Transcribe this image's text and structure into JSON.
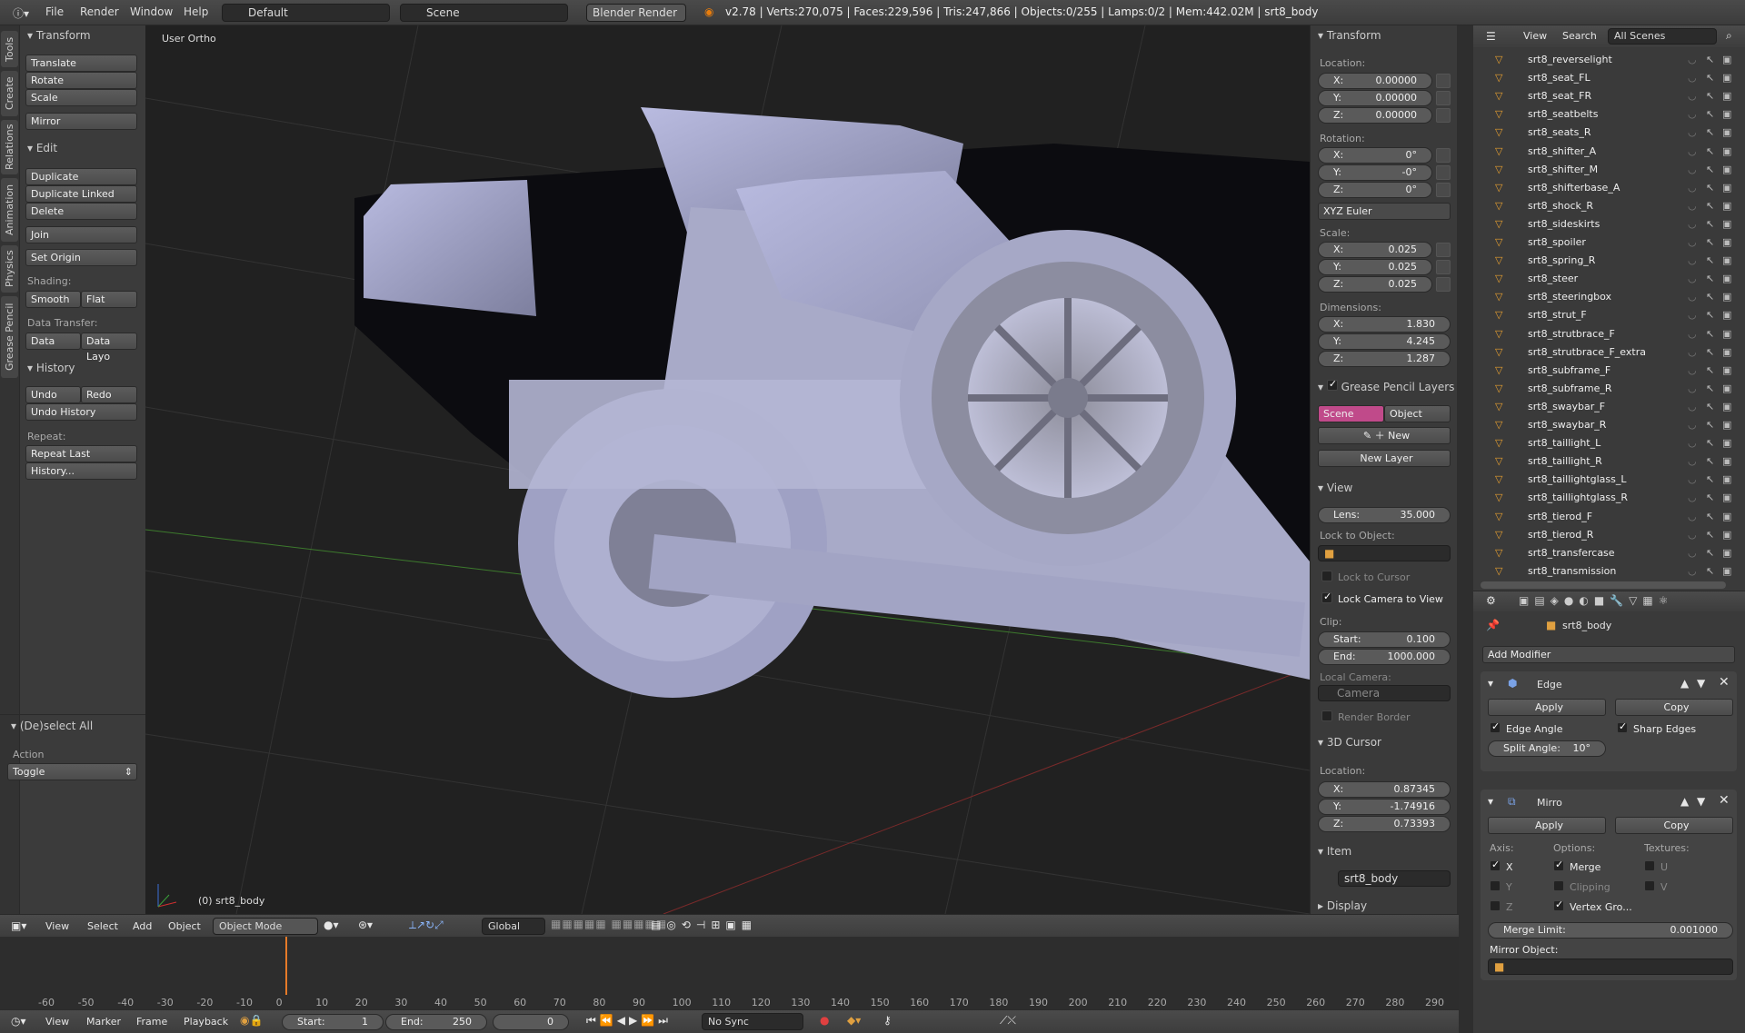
{
  "topbar": {
    "menus": [
      "File",
      "Render",
      "Window",
      "Help"
    ],
    "layout": "Default",
    "scene": "Scene",
    "engine": "Blender Render",
    "stats": "v2.78 | Verts:270,075 | Faces:229,596 | Tris:247,866 | Objects:0/255 | Lamps:0/2 | Mem:442.02M | srt8_body"
  },
  "vtabs": [
    "Tools",
    "Create",
    "Relations",
    "Animation",
    "Physics",
    "Grease Pencil"
  ],
  "tool": {
    "transform": "Transform",
    "translate": "Translate",
    "rotate": "Rotate",
    "scale": "Scale",
    "mirror": "Mirror",
    "edit": "Edit",
    "duplicate": "Duplicate",
    "duplicate_linked": "Duplicate Linked",
    "delete": "Delete",
    "join": "Join",
    "set_origin": "Set Origin",
    "shading": "Shading:",
    "smooth": "Smooth",
    "flat": "Flat",
    "data_transfer": "Data Transfer:",
    "data": "Data",
    "data_layo": "Data Layo",
    "history": "History",
    "undo": "Undo",
    "redo": "Redo",
    "undo_history": "Undo History",
    "repeat": "Repeat:",
    "repeat_last": "Repeat Last",
    "history_dots": "History...",
    "deselect": "(De)select All",
    "action": "Action",
    "toggle": "Toggle"
  },
  "viewport": {
    "label": "User Ortho",
    "object": "(0) srt8_body"
  },
  "props": {
    "transform": "Transform",
    "location": "Location:",
    "loc": [
      "0.00000",
      "0.00000",
      "0.00000"
    ],
    "rotation": "Rotation:",
    "rot": [
      "0°",
      "-0°",
      "0°"
    ],
    "euler": "XYZ Euler",
    "scale": "Scale:",
    "scl": [
      "0.025",
      "0.025",
      "0.025"
    ],
    "dimensions": "Dimensions:",
    "dim": [
      "1.830",
      "4.245",
      "1.287"
    ],
    "axes": [
      "X:",
      "Y:",
      "Z:"
    ],
    "grease": "Grease Pencil Layers",
    "scene_tab": "Scene",
    "object_tab": "Object",
    "new": "New",
    "new_layer": "New Layer",
    "view": "View",
    "lens_l": "Lens:",
    "lens": "35.000",
    "lock_obj": "Lock to Object:",
    "lock_cursor": "Lock to Cursor",
    "lock_cam": "Lock Camera to View",
    "clip": "Clip:",
    "start_l": "Start:",
    "start": "0.100",
    "end_l": "End:",
    "end": "1000.000",
    "local_cam": "Local Camera:",
    "camera": "Camera",
    "render_border": "Render Border",
    "cursor3d": "3D Cursor",
    "cloc": [
      "0.87345",
      "-1.74916",
      "0.73393"
    ],
    "item": "Item",
    "item_name": "srt8_body",
    "display": "Display"
  },
  "outliner": {
    "view": "View",
    "search": "Search",
    "scenes": "All Scenes",
    "items": [
      "srt8_reverselight",
      "srt8_seat_FL",
      "srt8_seat_FR",
      "srt8_seatbelts",
      "srt8_seats_R",
      "srt8_shifter_A",
      "srt8_shifter_M",
      "srt8_shifterbase_A",
      "srt8_shock_R",
      "srt8_sideskirts",
      "srt8_spoiler",
      "srt8_spring_R",
      "srt8_steer",
      "srt8_steeringbox",
      "srt8_strut_F",
      "srt8_strutbrace_F",
      "srt8_strutbrace_F_extra",
      "srt8_subframe_F",
      "srt8_subframe_R",
      "srt8_swaybar_F",
      "srt8_swaybar_R",
      "srt8_taillight_L",
      "srt8_taillight_R",
      "srt8_taillightglass_L",
      "srt8_taillightglass_R",
      "srt8_tierod_F",
      "srt8_tierod_R",
      "srt8_transfercase",
      "srt8_transmission"
    ]
  },
  "modifiers": {
    "object": "srt8_body",
    "add": "Add Modifier",
    "edge": "Edge",
    "apply": "Apply",
    "copy": "Copy",
    "edge_angle": "Edge Angle",
    "sharp_edges": "Sharp Edges",
    "split_angle": "Split Angle:",
    "split_val": "10°",
    "mirror": "Mirro",
    "axis": "Axis:",
    "options": "Options:",
    "textures": "Textures:",
    "x": "X",
    "y": "Y",
    "z": "Z",
    "merge": "Merge",
    "clipping": "Clipping",
    "vertex": "Vertex Gro...",
    "u": "U",
    "v": "V",
    "merge_limit": "Merge Limit:",
    "merge_val": "0.001000",
    "mirror_obj": "Mirror Object:"
  },
  "view3d_header": {
    "view": "View",
    "select": "Select",
    "add": "Add",
    "object": "Object",
    "mode": "Object Mode",
    "orient": "Global"
  },
  "timeline": {
    "ticks": [
      "-60",
      "-50",
      "-40",
      "-30",
      "-20",
      "-10",
      "0",
      "10",
      "20",
      "30",
      "40",
      "50",
      "60",
      "70",
      "80",
      "90",
      "100",
      "110",
      "120",
      "130",
      "140",
      "150",
      "160",
      "170",
      "180",
      "190",
      "200",
      "210",
      "220",
      "230",
      "240",
      "250",
      "260",
      "270",
      "280",
      "290"
    ],
    "view": "View",
    "marker": "Marker",
    "frame": "Frame",
    "playback": "Playback",
    "start_l": "Start:",
    "start": "1",
    "end_l": "End:",
    "end": "250",
    "current": "0",
    "sync": "No Sync"
  }
}
